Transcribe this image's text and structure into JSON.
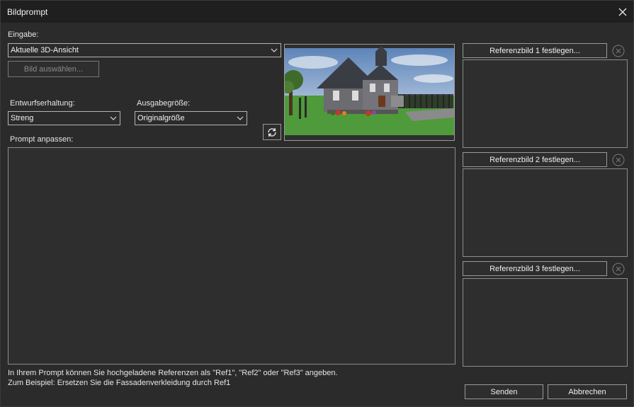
{
  "window": {
    "title": "Bildprompt"
  },
  "input": {
    "label": "Eingabe:",
    "source_value": "Aktuelle 3D-Ansicht",
    "select_image_label": "Bild auswählen..."
  },
  "design": {
    "label": "Entwurfserhaltung:",
    "value": "Streng"
  },
  "output": {
    "label": "Ausgabegröße:",
    "value": "Originalgröße"
  },
  "prompt": {
    "label": "Prompt anpassen:",
    "value": ""
  },
  "references": [
    {
      "label": "Referenzbild 1 festlegen..."
    },
    {
      "label": "Referenzbild 2 festlegen..."
    },
    {
      "label": "Referenzbild 3 festlegen..."
    }
  ],
  "info": {
    "line1": "In Ihrem Prompt können Sie hochgeladene Referenzen als \"Ref1\", \"Ref2\" oder \"Ref3\" angeben.",
    "line2": "Zum Beispiel: Ersetzen Sie die Fassadenverkleidung durch Ref1"
  },
  "buttons": {
    "send": "Senden",
    "cancel": "Abbrechen"
  },
  "colors": {
    "background": "#2b2b2b",
    "titlebar": "#1f1f1f",
    "border": "#8c8c8c"
  }
}
